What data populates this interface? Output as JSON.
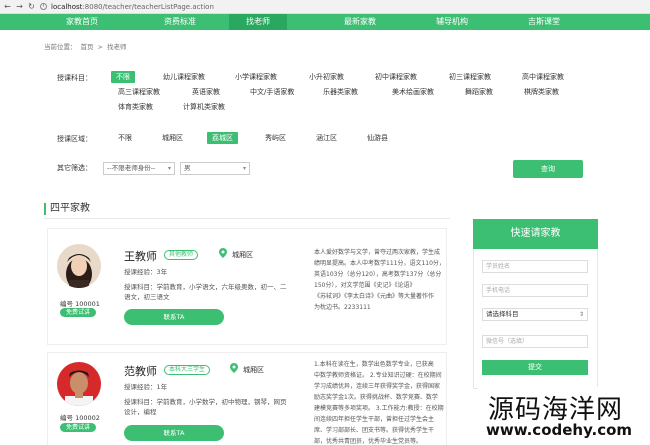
{
  "browser": {
    "url_host": "localhost",
    "url_rest": ":8080/teacher/teacherListPage.action"
  },
  "nav": [
    "家教首页",
    "资费标准",
    "找老师",
    "最新家教",
    "辅导机构",
    "吉斯课堂"
  ],
  "breadcrumb": {
    "label": "当前位置：",
    "home": "首页",
    "sep": ">",
    "current": "找老师"
  },
  "filters": {
    "subject_label": "授课科目：",
    "subjects": [
      "不限",
      "幼儿课程家教",
      "小学课程家教",
      "小升初家教",
      "初中课程家教",
      "初三课程家教",
      "高中课程家教",
      "高三课程家教",
      "英语家教",
      "中文/手语家教",
      "乐器类家教",
      "美术绘画家教",
      "舞蹈家教",
      "棋牌类家教",
      "体育类家教",
      "计算机类家教"
    ],
    "area_label": "授课区域：",
    "areas": [
      "不限",
      "城厢区",
      "荔城区",
      "秀屿区",
      "涵江区",
      "仙游县"
    ],
    "other_label": "其它筛选：",
    "identity_select": "--不限老师身份--",
    "gender_select": "男",
    "query_label": "查询"
  },
  "section_title": "四平家教",
  "teachers": [
    {
      "name": "王教师",
      "badge": "其他教师",
      "area": "城厢区",
      "experience": "授课经验：3年",
      "subjects_line1": "授课科目：学前教育，小学语文，六年级奥数，初一、二",
      "subjects_line2": "语文，初三语文",
      "id": "编号 100001",
      "free": "免费试讲",
      "contact": "联系TA",
      "desc": [
        "本人爱好数学与文学，曾夺过两次家教，学生成",
        "绩明显提高。本人中考数学111分，语文110分，",
        "英语103分（总分120），高考数学137分（总分",
        "150分），对文学范围《史记》《论语》",
        "《苏轼词》《李太白诗》《元曲》等大量著作作",
        "为枕边书。2233111"
      ]
    },
    {
      "name": "范教师",
      "badge": "本科大三学生",
      "area": "城厢区",
      "experience": "授课经验：1年",
      "subjects_line1": "授课科目：学前教育，小学数学，初中物理，钢琴，网页",
      "subjects_line2": "设计，编程",
      "id": "编号 100002",
      "free": "免费试讲",
      "contact": "联系TA",
      "desc": [
        "1.本科在读在生，数学出色数学专业，已获高",
        "中数学教师资格证。 2.专业知识过硬：在校期间",
        "学习成绩优异，连续三年获得奖学金，获得国家",
        "励志奖学金1次。获得挑战杯、数学竞赛、数学",
        "建模竞赛等多项奖项。 3.工作能力:教授：在校期",
        "间连续四年担任学生干部，曾担任过学生会主",
        "席、学习部部长、团支书等。获得优秀学生干",
        "部，优秀共青团员，优秀毕业生党员等。"
      ]
    }
  ],
  "panel": {
    "title": "快速请家教",
    "name_placeholder": "学员姓名",
    "phone_placeholder": "手机电话",
    "subject_select": "请选择科目",
    "note_placeholder": "微信号（选填）",
    "submit": "提交"
  },
  "watermark": {
    "cn": "源码海洋网",
    "url": "www.codehy.com"
  },
  "colors": {
    "brand": "#3cbf73"
  }
}
